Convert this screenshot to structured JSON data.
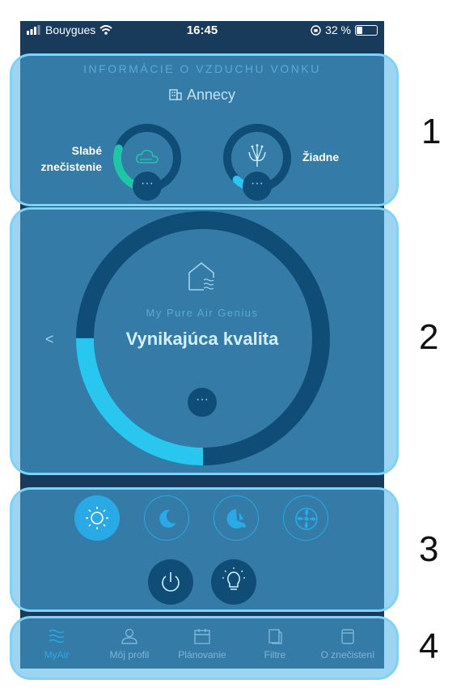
{
  "status_bar": {
    "carrier": "Bouygues",
    "time": "16:45",
    "battery": "32 %",
    "battery_level": 0.32
  },
  "outdoor": {
    "title": "INFORMÁCIE O VZDUCHU VONKU",
    "city": "Annecy",
    "pollution": {
      "label_line1": "Slabé",
      "label_line2": "znečistenie",
      "level": 0.3,
      "more": "···"
    },
    "pollen": {
      "label": "Žiadne",
      "level": 0.12,
      "more": "···"
    }
  },
  "main": {
    "back": "<",
    "device_name": "My Pure Air Genius",
    "quality": "Vynikajúca kvalita",
    "level": 0.25,
    "more": "···"
  },
  "modes": [
    {
      "name": "day-mode",
      "icon": "sun-icon"
    },
    {
      "name": "night-mode",
      "icon": "moon-icon"
    },
    {
      "name": "allergy-mode",
      "icon": "pollen-mode-icon"
    },
    {
      "name": "fan-mode",
      "icon": "fan-icon"
    },
    {
      "name": "power",
      "icon": "power-icon"
    },
    {
      "name": "light",
      "icon": "bulb-icon"
    }
  ],
  "nav": [
    {
      "label": "MyAir",
      "icon": "waves-icon",
      "active": true
    },
    {
      "label": "Môj profil",
      "icon": "person-icon"
    },
    {
      "label": "Plánovanie",
      "icon": "calendar-icon"
    },
    {
      "label": "Filtre",
      "icon": "filter-icon"
    },
    {
      "label": "O znečistení",
      "icon": "info-page-icon"
    }
  ],
  "sections": [
    "1",
    "2",
    "3",
    "4"
  ],
  "colors": {
    "accent": "#29a9e6",
    "ring_green": "#1fc6a6",
    "ring_cyan": "#29c6f0",
    "background": "#183b5b"
  }
}
